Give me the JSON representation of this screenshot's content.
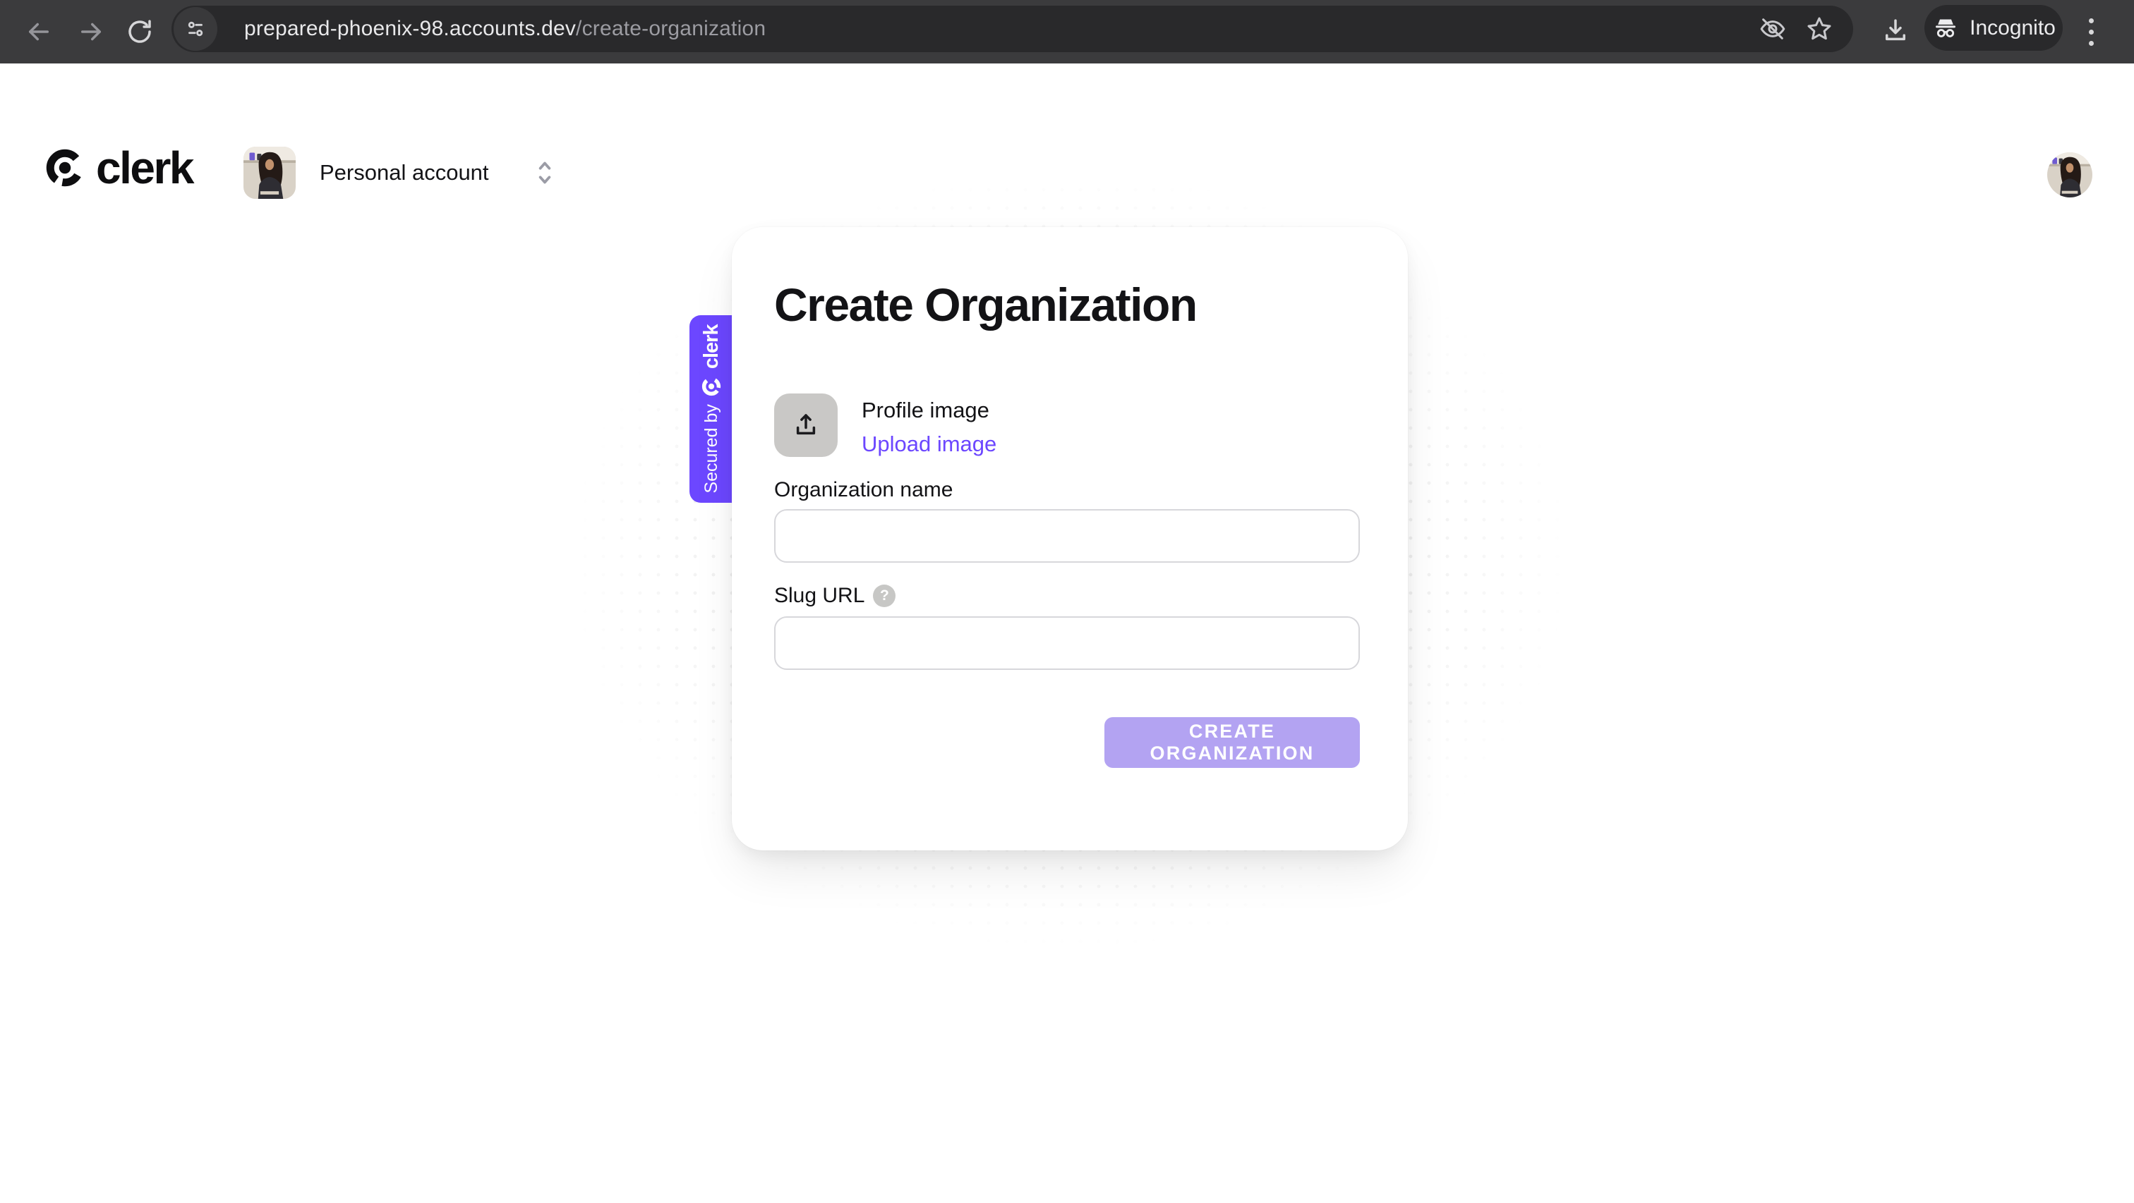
{
  "browser": {
    "url": {
      "domain": "prepared-phoenix-98.accounts.dev",
      "path": "/create-organization"
    },
    "incognito_label": "Incognito"
  },
  "header": {
    "brand": "clerk",
    "account_switcher_label": "Personal account"
  },
  "secured_badge": {
    "prefix": "Secured by",
    "brand": "clerk"
  },
  "card": {
    "title": "Create Organization",
    "profile_image_label": "Profile image",
    "upload_image_label": "Upload image",
    "organization_name": {
      "label": "Organization name",
      "value": ""
    },
    "slug_url": {
      "label": "Slug URL",
      "value": "",
      "help_glyph": "?"
    },
    "submit_label": "CREATE ORGANIZATION"
  },
  "colors": {
    "accent": "#6C47FF",
    "link": "#6C47FF",
    "submit_disabled_bg": "#B3A3F2",
    "toolbar_bg": "#3B3B3D",
    "urlbar_bg": "#29292B",
    "card_bg": "#FFFFFF"
  }
}
